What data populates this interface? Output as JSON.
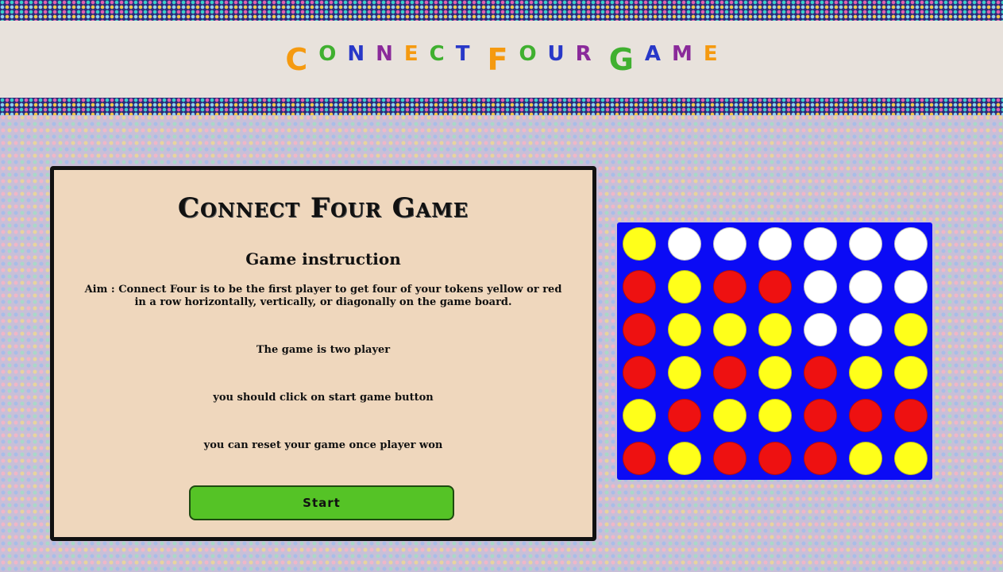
{
  "header": {
    "title": "ConnectFourGame"
  },
  "colors": {
    "title_letters": [
      "#f59a10",
      "#40b030",
      "#2838c8",
      "#8a2a9a",
      "#f59a10",
      "#40b030",
      "#2838c8",
      "#f59a10",
      "#40b030",
      "#2838c8",
      "#8a2a9a",
      "#40b030",
      "#2838c8",
      "#8a2a9a",
      "#f59a10"
    ],
    "board": "#0b0bf5",
    "red": "#ee1111",
    "yellow": "#ffff1a",
    "empty": "#ffffff",
    "start_button": "#55c326"
  },
  "panel": {
    "title": "Connect Four Game",
    "instruction_heading": "Game instruction",
    "aim": "Aim : Connect Four is to be the first player to get four of your tokens yellow or red in a row horizontally, vertically, or diagonally on the game board.",
    "line_two_player": "The game is two player",
    "line_start": "you should click on start game button",
    "line_reset": "you can reset your game once player won",
    "start_label": "Start"
  },
  "board": {
    "rows": [
      [
        "yellow",
        "empty",
        "empty",
        "empty",
        "empty",
        "empty",
        "empty"
      ],
      [
        "red",
        "yellow",
        "red",
        "red",
        "empty",
        "empty",
        "empty"
      ],
      [
        "red",
        "yellow",
        "yellow",
        "yellow",
        "empty",
        "empty",
        "yellow"
      ],
      [
        "red",
        "yellow",
        "red",
        "yellow",
        "red",
        "yellow",
        "yellow"
      ],
      [
        "yellow",
        "red",
        "yellow",
        "yellow",
        "red",
        "red",
        "red"
      ],
      [
        "red",
        "yellow",
        "red",
        "red",
        "red",
        "yellow",
        "yellow"
      ]
    ]
  }
}
